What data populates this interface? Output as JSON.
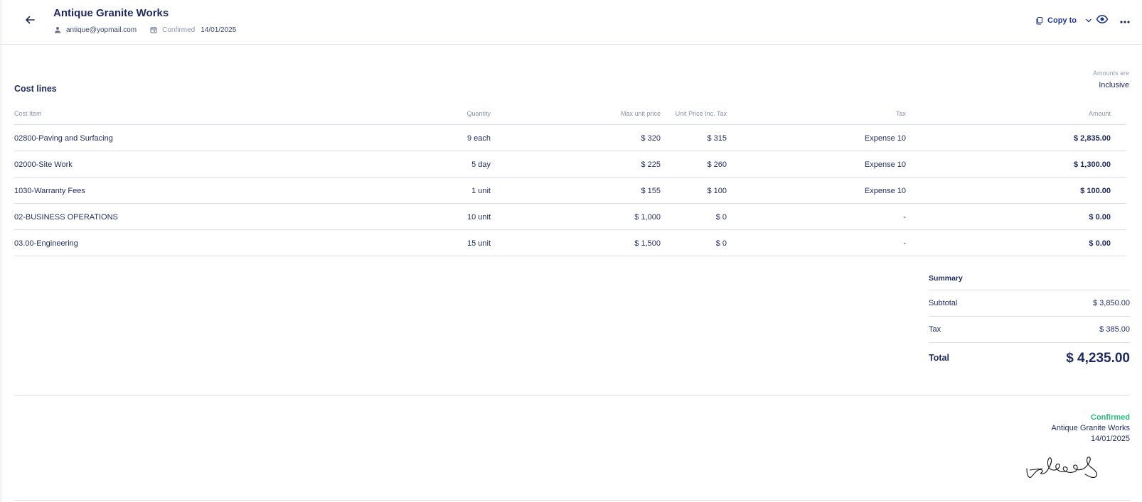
{
  "header": {
    "title": "Antique Granite Works",
    "email": "antique@yopmail.com",
    "status": "Confirmed",
    "date": "14/01/2025",
    "copy_label": "Copy to"
  },
  "amounts": {
    "label": "Amounts are",
    "value": "Inclusive"
  },
  "cost_lines": {
    "title": "Cost lines",
    "columns": {
      "item": "Cost Item",
      "quantity": "Quantity",
      "max_price": "Max unit price",
      "unit_price": "Unit Price Inc. Tax",
      "tax": "Tax",
      "amount": "Amount"
    },
    "rows": [
      {
        "item": "02800-Paving and Surfacing",
        "quantity": "9 each",
        "max_price": "$ 320",
        "unit_price": "$ 315",
        "tax": "Expense 10",
        "amount": "$ 2,835.00"
      },
      {
        "item": "02000-Site Work",
        "quantity": "5 day",
        "max_price": "$ 225",
        "unit_price": "$ 260",
        "tax": "Expense 10",
        "amount": "$ 1,300.00"
      },
      {
        "item": "1030-Warranty Fees",
        "quantity": "1 unit",
        "max_price": "$ 155",
        "unit_price": "$ 100",
        "tax": "Expense 10",
        "amount": "$ 100.00"
      },
      {
        "item": "02-BUSINESS OPERATIONS",
        "quantity": "10 unit",
        "max_price": "$ 1,000",
        "unit_price": "$ 0",
        "tax": "-",
        "amount": "$ 0.00"
      },
      {
        "item": "03.00-Engineering",
        "quantity": "15 unit",
        "max_price": "$ 1,500",
        "unit_price": "$ 0",
        "tax": "-",
        "amount": "$ 0.00"
      }
    ]
  },
  "summary": {
    "title": "Summary",
    "subtotal_label": "Subtotal",
    "subtotal_value": "$ 3,850.00",
    "tax_label": "Tax",
    "tax_value": "$ 385.00",
    "total_label": "Total",
    "total_value": "$ 4,235.00"
  },
  "confirmation": {
    "status": "Confirmed",
    "company": "Antique Granite Works",
    "date": "14/01/2025"
  },
  "colors": {
    "text": "#1f2a5c",
    "accent": "#1f3a8a",
    "muted": "#8c93ad",
    "confirmed": "#22c07a",
    "divider": "#d9dce6"
  },
  "icons": {
    "back": "arrow-left-icon",
    "user": "user-icon",
    "calendar": "calendar-icon",
    "copy": "copy-icon",
    "chevron": "chevron-down-icon",
    "eye": "eye-icon",
    "more": "more-horizontal-icon"
  }
}
